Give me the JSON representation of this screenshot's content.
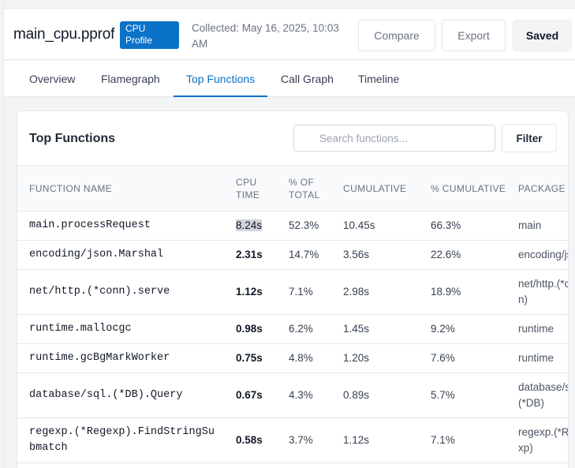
{
  "header": {
    "file_name": "main_cpu.pprof",
    "badge": "CPU Profile",
    "collected": "Collected: May 16, 2025, 10:03 AM",
    "buttons": {
      "compare": "Compare",
      "export": "Export",
      "saved": "Saved"
    }
  },
  "tabs": [
    {
      "label": "Overview"
    },
    {
      "label": "Flamegraph"
    },
    {
      "label": "Top Functions"
    },
    {
      "label": "Call Graph"
    },
    {
      "label": "Timeline"
    }
  ],
  "active_tab": "Top Functions",
  "panel": {
    "title": "Top Functions",
    "search_placeholder": "Search functions...",
    "filter_label": "Filter"
  },
  "table": {
    "columns": {
      "function": "FUNCTION NAME",
      "cpu": "CPU TIME",
      "pct": "% OF TOTAL",
      "cum": "CUMULATIVE",
      "pct_cum": "% CUMULATIVE",
      "pkg": "PACKAGE"
    },
    "rows": [
      {
        "function": "main.processRequest",
        "cpu": "8.24s",
        "pct": "52.3%",
        "cum": "10.45s",
        "pct_cum": "66.3%",
        "pkg": "main"
      },
      {
        "function": "encoding/json.Marshal",
        "cpu": "2.31s",
        "pct": "14.7%",
        "cum": "3.56s",
        "pct_cum": "22.6%",
        "pkg": "encoding/json"
      },
      {
        "function": "net/http.(*conn).serve",
        "cpu": "1.12s",
        "pct": "7.1%",
        "cum": "2.98s",
        "pct_cum": "18.9%",
        "pkg": "net/http.(*conn)"
      },
      {
        "function": "runtime.mallocgc",
        "cpu": "0.98s",
        "pct": "6.2%",
        "cum": "1.45s",
        "pct_cum": "9.2%",
        "pkg": "runtime"
      },
      {
        "function": "runtime.gcBgMarkWorker",
        "cpu": "0.75s",
        "pct": "4.8%",
        "cum": "1.20s",
        "pct_cum": "7.6%",
        "pkg": "runtime"
      },
      {
        "function": "database/sql.(*DB).Query",
        "cpu": "0.67s",
        "pct": "4.3%",
        "cum": "0.89s",
        "pct_cum": "5.7%",
        "pkg": "database/sql.(*DB)"
      },
      {
        "function": "regexp.(*Regexp).FindStringSubmatch",
        "cpu": "0.58s",
        "pct": "3.7%",
        "cum": "1.12s",
        "pct_cum": "7.1%",
        "pkg": "regexp.(*Regexp)"
      }
    ]
  },
  "colors": {
    "accent": "#0b72c9",
    "highlight": "#d1d5db"
  }
}
